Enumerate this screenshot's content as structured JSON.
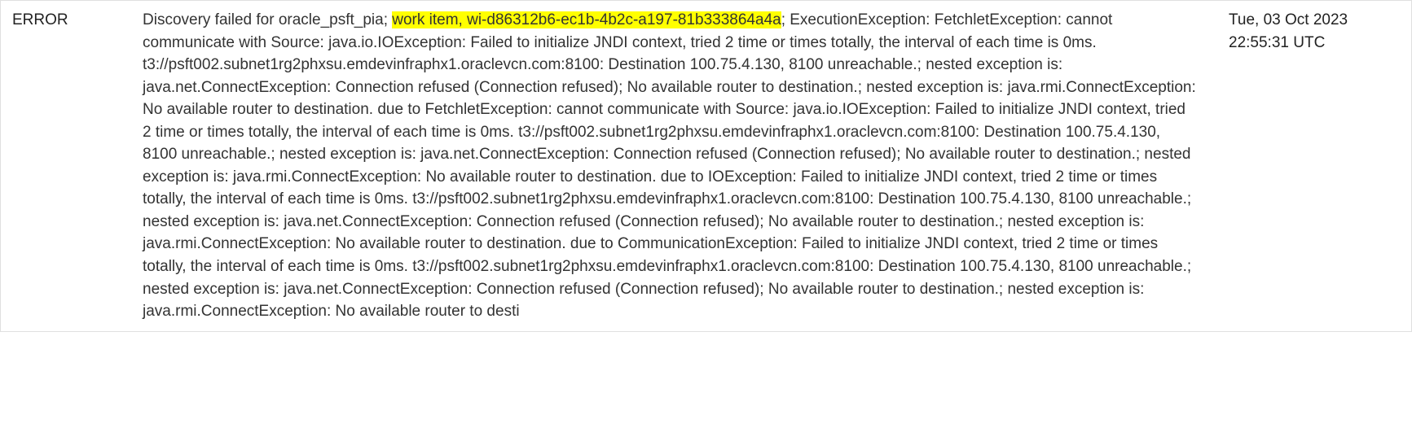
{
  "log": {
    "level": "ERROR",
    "timestamp": "Tue, 03 Oct 2023 22:55:31 UTC",
    "message_pre": "Discovery failed for oracle_psft_pia; ",
    "message_highlight": "work item, wi-d86312b6-ec1b-4b2c-a197-81b333864a4a",
    "message_post": "; ExecutionException: FetchletException: cannot communicate with Source: java.io.IOException: Failed to initialize JNDI context, tried 2 time or times totally, the interval of each time is 0ms. t3://psft002.subnet1rg2phxsu.emdevinfraphx1.oraclevcn.com:8100: Destination 100.75.4.130, 8100 unreachable.; nested exception is: java.net.ConnectException: Connection refused (Connection refused); No available router to destination.; nested exception is: java.rmi.ConnectException: No available router to destination. due to FetchletException: cannot communicate with Source: java.io.IOException: Failed to initialize JNDI context, tried 2 time or times totally, the interval of each time is 0ms. t3://psft002.subnet1rg2phxsu.emdevinfraphx1.oraclevcn.com:8100: Destination 100.75.4.130, 8100 unreachable.; nested exception is: java.net.ConnectException: Connection refused (Connection refused); No available router to destination.; nested exception is: java.rmi.ConnectException: No available router to destination. due to IOException: Failed to initialize JNDI context, tried 2 time or times totally, the interval of each time is 0ms. t3://psft002.subnet1rg2phxsu.emdevinfraphx1.oraclevcn.com:8100: Destination 100.75.4.130, 8100 unreachable.; nested exception is: java.net.ConnectException: Connection refused (Connection refused); No available router to destination.; nested exception is: java.rmi.ConnectException: No available router to destination. due to CommunicationException: Failed to initialize JNDI context, tried 2 time or times totally, the interval of each time is 0ms. t3://psft002.subnet1rg2phxsu.emdevinfraphx1.oraclevcn.com:8100: Destination 100.75.4.130, 8100 unreachable.; nested exception is: java.net.ConnectException: Connection refused (Connection refused); No available router to destination.; nested exception is: java.rmi.ConnectException: No available router to desti"
  }
}
